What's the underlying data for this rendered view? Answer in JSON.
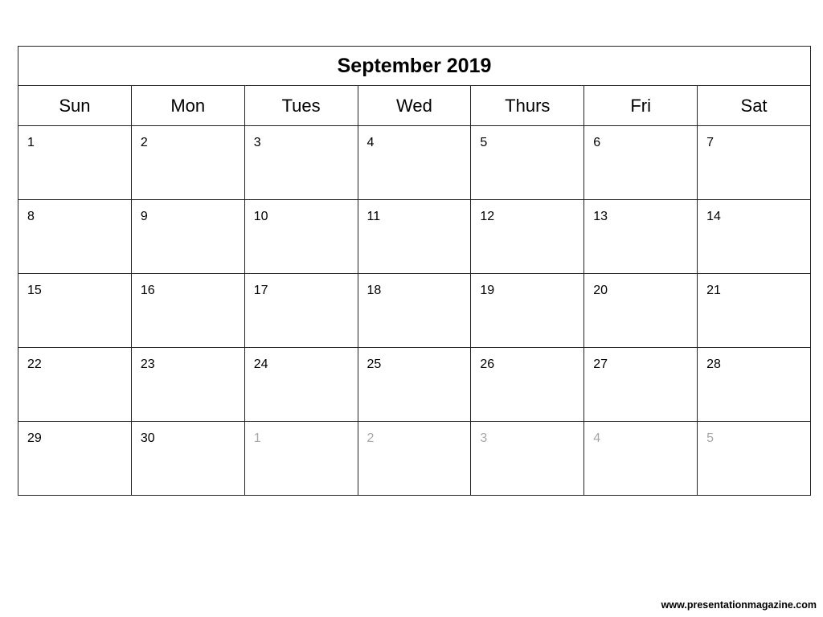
{
  "calendar": {
    "title": "September 2019",
    "weekdays": [
      "Sun",
      "Mon",
      "Tues",
      "Wed",
      "Thurs",
      "Fri",
      "Sat"
    ],
    "weeks": [
      [
        {
          "d": "1"
        },
        {
          "d": "2"
        },
        {
          "d": "3"
        },
        {
          "d": "4"
        },
        {
          "d": "5"
        },
        {
          "d": "6"
        },
        {
          "d": "7"
        }
      ],
      [
        {
          "d": "8"
        },
        {
          "d": "9"
        },
        {
          "d": "10"
        },
        {
          "d": "11"
        },
        {
          "d": "12"
        },
        {
          "d": "13"
        },
        {
          "d": "14"
        }
      ],
      [
        {
          "d": "15"
        },
        {
          "d": "16"
        },
        {
          "d": "17"
        },
        {
          "d": "18"
        },
        {
          "d": "19"
        },
        {
          "d": "20"
        },
        {
          "d": "21"
        }
      ],
      [
        {
          "d": "22"
        },
        {
          "d": "23"
        },
        {
          "d": "24"
        },
        {
          "d": "25"
        },
        {
          "d": "26"
        },
        {
          "d": "27"
        },
        {
          "d": "28"
        }
      ],
      [
        {
          "d": "29"
        },
        {
          "d": "30"
        },
        {
          "d": "1",
          "other": true
        },
        {
          "d": "2",
          "other": true
        },
        {
          "d": "3",
          "other": true
        },
        {
          "d": "4",
          "other": true
        },
        {
          "d": "5",
          "other": true
        }
      ]
    ],
    "other_month_color": "#a6a6a6"
  },
  "footer": {
    "url_text": "www.presentationmagazine.com"
  }
}
